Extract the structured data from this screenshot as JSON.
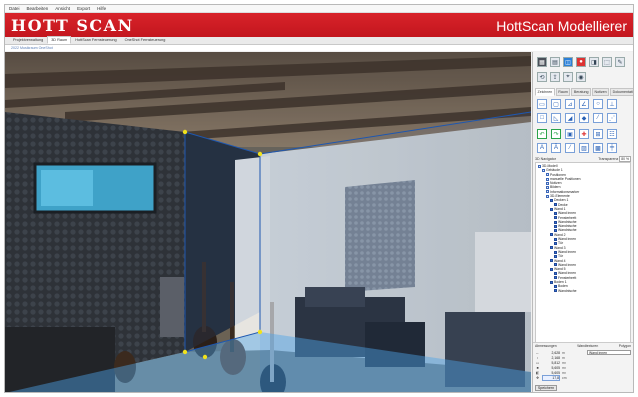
{
  "menu": [
    "Datei",
    "Bearbeiten",
    "Ansicht",
    "Export",
    "Hilfe"
  ],
  "banner": {
    "logo": "HOTT SCAN",
    "title": "HottScan Modellierer",
    "brand_color": "#c8151c"
  },
  "tabs": [
    "Projektverwaltung",
    "3D Raum",
    "HottScan Fernsteuerung",
    "OneShot Fernsteuerung"
  ],
  "active_tab": "3D Raum",
  "status": "2022 Musikraum OneShot",
  "panel": {
    "tabs": [
      "Zeichnen",
      "Raum",
      "Beratung",
      "Notizen",
      "Dokumentation"
    ],
    "nav_label": "3D Navigator",
    "transparency_label": "Transparenz",
    "transparency_value": "80 %",
    "tree": [
      {
        "label": "3D-Modell",
        "depth": 0
      },
      {
        "label": "Gebäude 1",
        "depth": 1
      },
      {
        "label": "Positionen",
        "depth": 2
      },
      {
        "label": "manuelle Positionen",
        "depth": 2
      },
      {
        "label": "Notizen",
        "depth": 2
      },
      {
        "label": "Bildern",
        "depth": 2
      },
      {
        "label": "Informationsmarker",
        "depth": 2
      },
      {
        "label": "3D-Elemente",
        "depth": 2
      },
      {
        "label": "Decken 1",
        "depth": 3
      },
      {
        "label": "Decke",
        "depth": 4
      },
      {
        "label": "Wand 1",
        "depth": 3
      },
      {
        "label": "Wand innen",
        "depth": 4
      },
      {
        "label": "Fensterbrett",
        "depth": 4
      },
      {
        "label": "Wandnische",
        "depth": 4
      },
      {
        "label": "Wandnische",
        "depth": 4
      },
      {
        "label": "Wandnische",
        "depth": 4
      },
      {
        "label": "Wand 2",
        "depth": 3
      },
      {
        "label": "Wand innen",
        "depth": 4
      },
      {
        "label": "Tür",
        "depth": 4
      },
      {
        "label": "Wand 3",
        "depth": 3
      },
      {
        "label": "Wand innen",
        "depth": 4
      },
      {
        "label": "Tür",
        "depth": 4
      },
      {
        "label": "Wand 4",
        "depth": 3
      },
      {
        "label": "Wand innen",
        "depth": 4
      },
      {
        "label": "Wand 5",
        "depth": 3
      },
      {
        "label": "Wand innen",
        "depth": 4
      },
      {
        "label": "Fensterbrett",
        "depth": 4
      },
      {
        "label": "Boden 1",
        "depth": 3
      },
      {
        "label": "Boden",
        "depth": 4
      },
      {
        "label": "Wandnische",
        "depth": 4
      }
    ],
    "props": {
      "header_left": "Abmessungen",
      "header_mid": "Wandtexturen",
      "header_right": "Polygon",
      "rows": [
        {
          "icon": "↔",
          "value": "2,628",
          "unit": "m"
        },
        {
          "icon": "↕",
          "value": "2,168",
          "unit": "m"
        },
        {
          "icon": "▭",
          "value": "5,812",
          "unit": "m²"
        },
        {
          "icon": "■",
          "value": "5,605",
          "unit": "m²"
        },
        {
          "icon": "◧",
          "value": "5,605",
          "unit": "m²"
        },
        {
          "icon": "✥",
          "value": "17,8",
          "unit": "cm"
        }
      ],
      "texture": "Wand innen",
      "save_label": "Speichern"
    }
  }
}
